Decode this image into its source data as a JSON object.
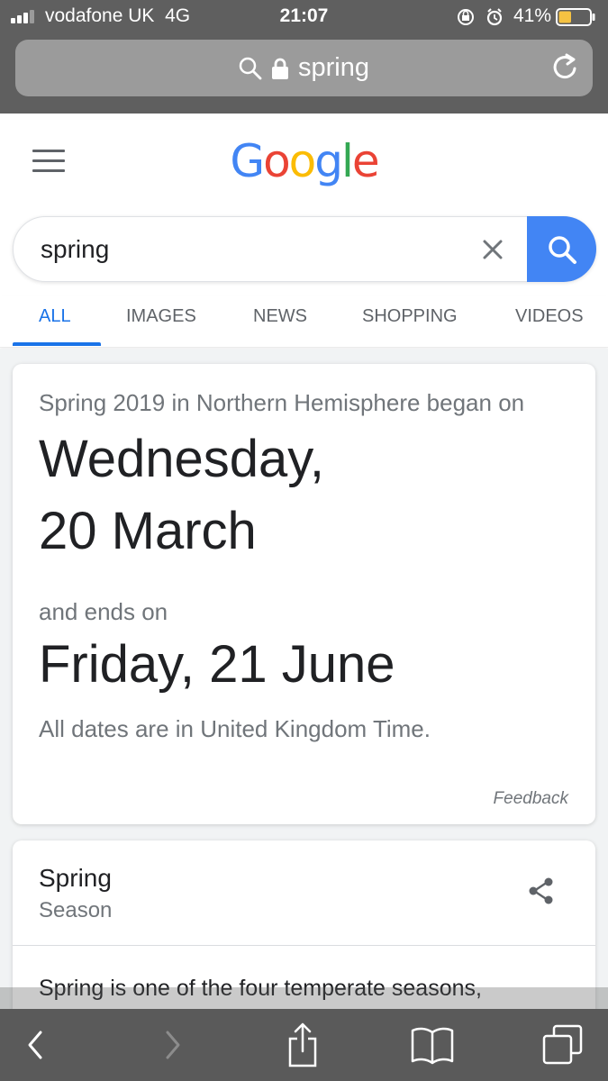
{
  "status_bar": {
    "carrier": "vodafone UK",
    "network": "4G",
    "time": "21:07",
    "battery_percent": "41%",
    "battery_level": 0.41,
    "battery_color": "#f5c242"
  },
  "address_bar": {
    "url_text": "spring",
    "lock_icon": "lock-icon",
    "search_icon": "search-icon",
    "reload_icon": "reload-icon"
  },
  "google": {
    "logo_letters": [
      "G",
      "o",
      "o",
      "g",
      "l",
      "e"
    ],
    "menu_icon": "hamburger-menu-icon"
  },
  "search": {
    "value": "spring",
    "clear_icon": "close-icon",
    "search_button_color": "#4285f4"
  },
  "tabs": [
    {
      "label": "ALL",
      "active": true
    },
    {
      "label": "IMAGES",
      "active": false
    },
    {
      "label": "NEWS",
      "active": false
    },
    {
      "label": "SHOPPING",
      "active": false
    },
    {
      "label": "VIDEOS",
      "active": false
    }
  ],
  "answer": {
    "intro": "Spring 2019 in Northern Hemisphere began on",
    "start_line1": "Wednesday,",
    "start_line2": "20 March",
    "ends_label": "and ends on",
    "end_date": "Friday, 21 June",
    "timezone_note": "All dates are in United Kingdom Time.",
    "feedback": "Feedback"
  },
  "knowledge": {
    "title": "Spring",
    "subtitle": "Season",
    "description": "Spring is one of the four temperate seasons,",
    "share_icon": "share-icon"
  },
  "toolbar": {
    "back_icon": "back-chevron-icon",
    "forward_icon": "forward-chevron-icon",
    "share_icon": "share-upload-icon",
    "bookmarks_icon": "bookmarks-book-icon",
    "tabs_icon": "tabs-icon"
  }
}
